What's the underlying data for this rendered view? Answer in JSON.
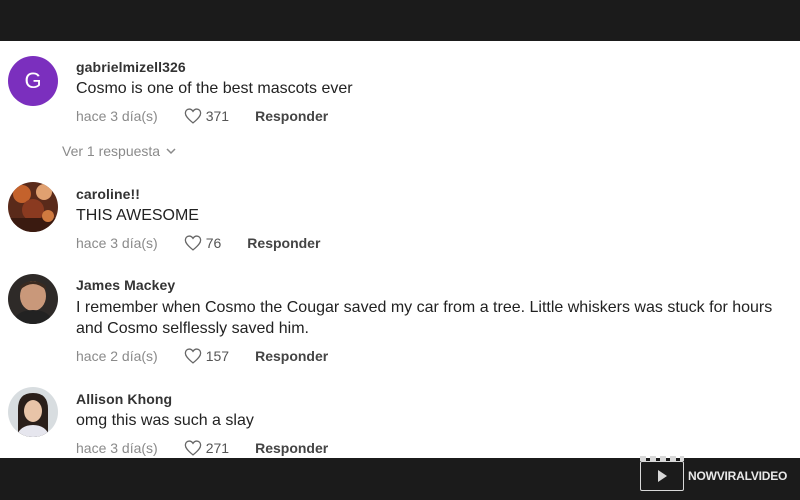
{
  "comments": [
    {
      "avatar_letter": "G",
      "username": "gabrielmizell326",
      "text": "Cosmo is one of the best mascots ever",
      "time": "hace 3 día(s)",
      "likes": "371",
      "reply_label": "Responder"
    },
    {
      "username": "caroline!!",
      "text": "THIS AWESOME",
      "time": "hace 3 día(s)",
      "likes": "76",
      "reply_label": "Responder"
    },
    {
      "username": "James Mackey",
      "text": "I remember when Cosmo the Cougar saved my car from a tree. Little whiskers was stuck for hours and Cosmo selflessly saved him.",
      "time": "hace 2 día(s)",
      "likes": "157",
      "reply_label": "Responder"
    },
    {
      "username": "Allison Khong",
      "text": "omg this was such a slay",
      "time": "hace 3 día(s)",
      "likes": "271",
      "reply_label": "Responder"
    }
  ],
  "view_replies_label": "Ver 1 respuesta",
  "watermark": {
    "logo_text": "NOWVIRALVIDEO"
  },
  "colors": {
    "avatar_g": "#7b2fbe",
    "background": "#ffffff",
    "frame": "#1b1b1b"
  }
}
